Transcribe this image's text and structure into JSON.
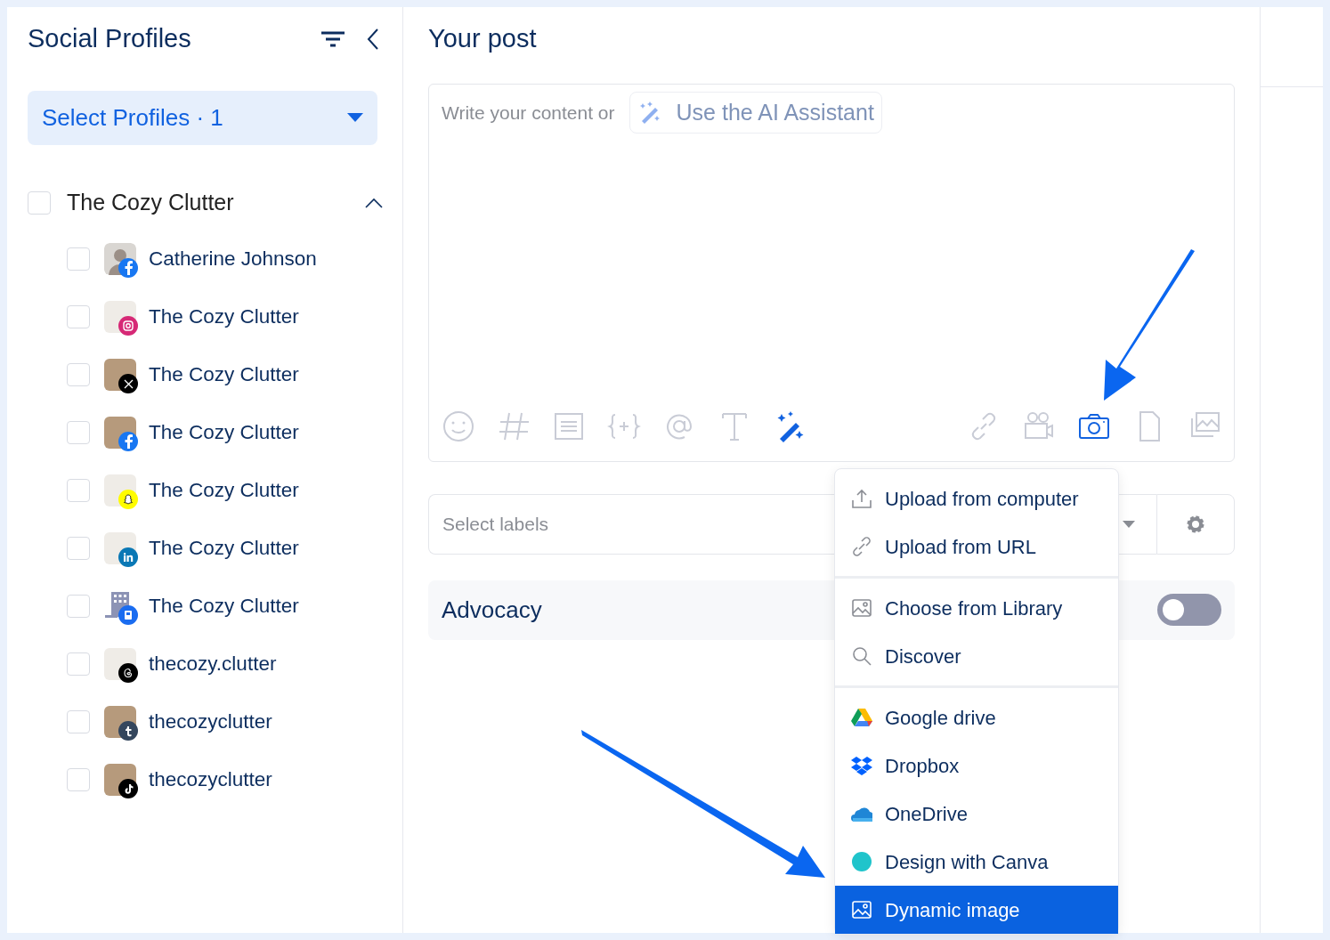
{
  "sidebar": {
    "title": "Social Profiles",
    "select": "Select Profiles · 1",
    "group": {
      "name": "The Cozy Clutter",
      "checked": false,
      "expanded": true,
      "profiles": [
        {
          "name": "Catherine Johnson",
          "checked": false,
          "avatar": {
            "kind": "person"
          },
          "kind": "facebook",
          "color": "#1877f2"
        },
        {
          "name": "The Cozy Clutter",
          "checked": false,
          "avatar": {
            "kind": "logo"
          },
          "kind": "instagram",
          "color": "#d62976"
        },
        {
          "name": "The Cozy Clutter",
          "checked": false,
          "avatar": {
            "kind": "photo"
          },
          "kind": "x",
          "color": "#000000"
        },
        {
          "name": "The Cozy Clutter",
          "checked": false,
          "avatar": {
            "kind": "photo"
          },
          "kind": "facebook",
          "color": "#1877f2"
        },
        {
          "name": "The Cozy Clutter",
          "checked": false,
          "avatar": {
            "kind": "logo"
          },
          "kind": "snapchat",
          "color": "#fffc00"
        },
        {
          "name": "The Cozy Clutter",
          "checked": false,
          "avatar": {
            "kind": "logo"
          },
          "kind": "linkedin",
          "color": "#0a78b5"
        },
        {
          "name": "The Cozy Clutter",
          "checked": false,
          "avatar": {
            "kind": "building"
          },
          "kind": "gmb",
          "color": "#1a6cf0"
        },
        {
          "name": "thecozy.clutter",
          "checked": false,
          "avatar": {
            "kind": "logo"
          },
          "kind": "threads",
          "color": "#000000"
        },
        {
          "name": "thecozyclutter",
          "checked": false,
          "avatar": {
            "kind": "photo"
          },
          "kind": "tumblr",
          "color": "#34465d"
        },
        {
          "name": "thecozyclutter",
          "checked": false,
          "avatar": {
            "kind": "photo"
          },
          "kind": "tiktok",
          "color": "#000000"
        }
      ]
    }
  },
  "post": {
    "title": "Your post",
    "placeholder": "Write your content or",
    "ai_button": "Use the AI Assistant",
    "tools_left": [
      {
        "kind": "emoji",
        "active": false
      },
      {
        "kind": "hash",
        "active": false
      },
      {
        "kind": "lines",
        "active": false
      },
      {
        "kind": "braces",
        "active": false
      },
      {
        "kind": "at",
        "active": false
      },
      {
        "kind": "text",
        "active": false
      },
      {
        "kind": "wand",
        "active": true
      }
    ],
    "tools_right": [
      {
        "kind": "link",
        "active": false
      },
      {
        "kind": "video",
        "active": false
      },
      {
        "kind": "camera",
        "active": true
      },
      {
        "kind": "file",
        "active": false
      },
      {
        "kind": "gallery",
        "active": false
      }
    ],
    "labels": {
      "placeholder": "Select labels"
    },
    "advocacy": {
      "label": "Advocacy",
      "on": false
    }
  },
  "menu": [
    [
      {
        "label": "Upload from computer",
        "kind": "upload",
        "selected": false
      },
      {
        "label": "Upload from URL",
        "kind": "link",
        "selected": false
      }
    ],
    [
      {
        "label": "Choose from Library",
        "kind": "image",
        "selected": false
      },
      {
        "label": "Discover",
        "kind": "search",
        "selected": false
      }
    ],
    [
      {
        "label": "Google drive",
        "kind": "gdrive",
        "selected": false
      },
      {
        "label": "Dropbox",
        "kind": "dropbox",
        "selected": false
      },
      {
        "label": "OneDrive",
        "kind": "onedrive",
        "selected": false
      },
      {
        "label": "Design with Canva",
        "kind": "canva",
        "selected": false
      },
      {
        "label": "Dynamic image",
        "kind": "dynimage",
        "selected": true
      }
    ]
  ]
}
